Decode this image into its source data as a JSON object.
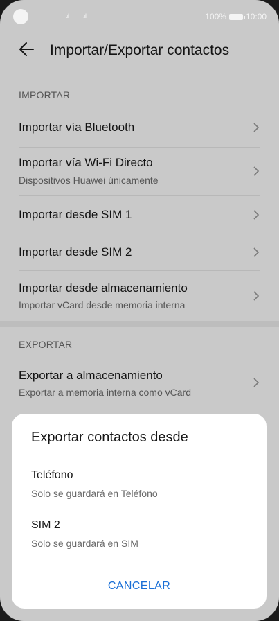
{
  "status_bar": {
    "signal1": ".ıl",
    "signal2": ".ıl",
    "battery_text": "100%",
    "time": "10:00"
  },
  "header": {
    "title": "Importar/Exportar contactos",
    "back_icon": "arrow-left-icon"
  },
  "import_section": {
    "label": "IMPORTAR",
    "items": [
      {
        "title": "Importar vía Bluetooth",
        "subtitle": ""
      },
      {
        "title": "Importar vía Wi-Fi Directo",
        "subtitle": "Dispositivos Huawei únicamente"
      },
      {
        "title": "Importar desde SIM 1",
        "subtitle": ""
      },
      {
        "title": "Importar desde SIM 2",
        "subtitle": ""
      },
      {
        "title": "Importar desde almacenamiento",
        "subtitle": "Importar vCard desde memoria interna"
      }
    ]
  },
  "export_section": {
    "label": "EXPORTAR",
    "items": [
      {
        "title": "Exportar a almacenamiento",
        "subtitle": "Exportar a memoria interna como vCard"
      }
    ]
  },
  "dialog": {
    "title": "Exportar contactos desde",
    "options": [
      {
        "title": "Teléfono",
        "subtitle": "Solo se guardará en Teléfono"
      },
      {
        "title": "SIM 2",
        "subtitle": "Solo se guardará en SIM"
      }
    ],
    "cancel_label": "CANCELAR"
  },
  "colors": {
    "accent": "#1a6fd6",
    "scrim_background": "#c9c9c9",
    "dialog_background": "#ffffff"
  }
}
